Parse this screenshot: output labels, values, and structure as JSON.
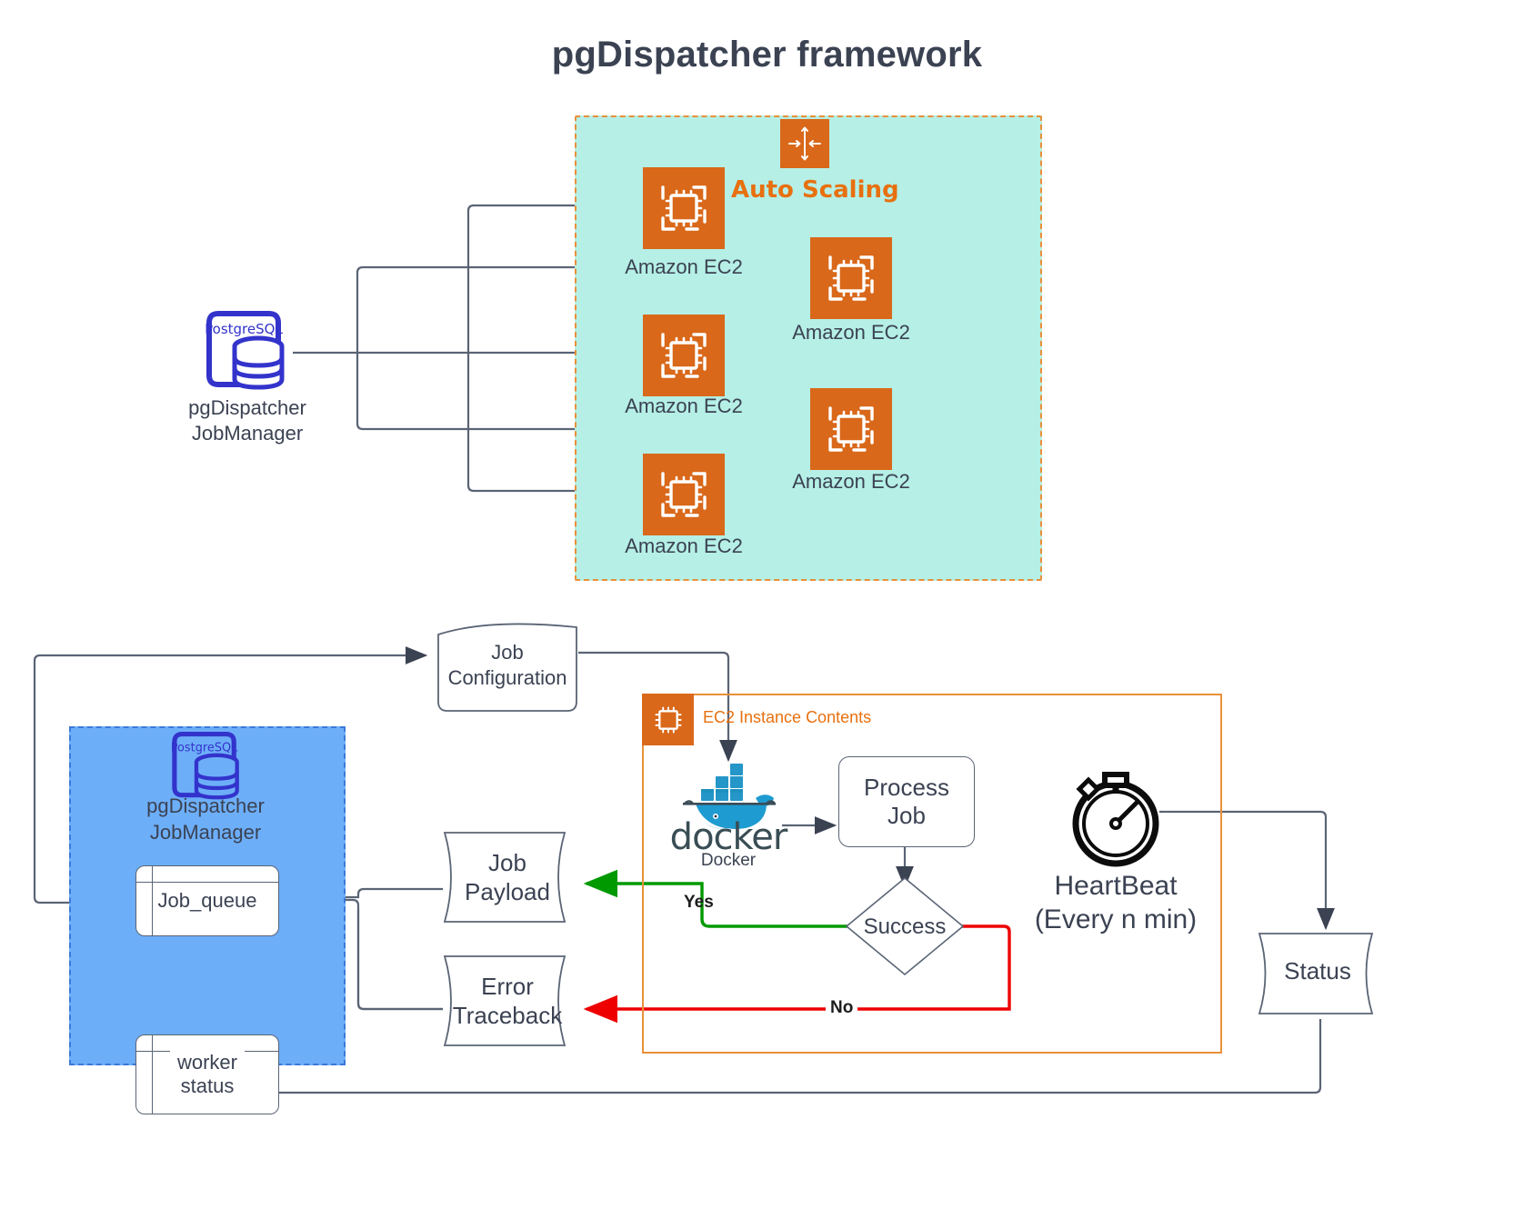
{
  "title": "pgDispatcher framework",
  "top_section": {
    "autoscaling": {
      "label": "Auto Scaling",
      "icon": "auto-scaling-icon",
      "instances": [
        {
          "label": "Amazon EC2",
          "icon": "amazon-ec2-icon"
        },
        {
          "label": "Amazon EC2",
          "icon": "amazon-ec2-icon"
        },
        {
          "label": "Amazon EC2",
          "icon": "amazon-ec2-icon"
        },
        {
          "label": "Amazon EC2",
          "icon": "amazon-ec2-icon"
        },
        {
          "label": "Amazon EC2",
          "icon": "amazon-ec2-icon"
        }
      ]
    },
    "jobmanager": {
      "icon": "postgresql-database-icon",
      "icon_text": "PostgreSQL",
      "line1": "pgDispatcher",
      "line2": "JobManager"
    }
  },
  "bottom_section": {
    "job_configuration": "Job\nConfiguration",
    "job_configuration_line1": "Job",
    "job_configuration_line2": "Configuration",
    "jobmanager_panel": {
      "icon": "postgresql-database-icon",
      "icon_text": "PostgreSQL",
      "line1": "pgDispatcher",
      "line2": "JobManager",
      "tables": [
        {
          "label": "Job_queue"
        },
        {
          "label_line1": "worker",
          "label_line2": "status"
        }
      ]
    },
    "ec2_instance_contents": {
      "label": "EC2 Instance Contents",
      "icon": "amazon-ec2-icon"
    },
    "docker": {
      "label": "Docker",
      "wordmark": "docker",
      "icon": "docker-whale-icon"
    },
    "process_job_line1": "Process",
    "process_job_line2": "Job",
    "decision": "Success",
    "yes_label": "Yes",
    "no_label": "No",
    "job_payload_line1": "Job",
    "job_payload_line2": "Payload",
    "error_traceback_line1": "Error",
    "error_traceback_line2": "Traceback",
    "heartbeat_line1": "HeartBeat",
    "heartbeat_line2": "(Every n min)",
    "heartbeat_icon": "stopwatch-icon",
    "status": "Status"
  },
  "colors": {
    "aws_orange": "#D9681A",
    "asg_fill": "#B5EFE6",
    "asg_border": "#E8903A",
    "postgres_blue": "#3333CC",
    "panel_blue": "#6DAEF9",
    "success_green": "#009900",
    "fail_red": "#EE0000",
    "line": "#5A6475",
    "text": "#3B4252"
  }
}
